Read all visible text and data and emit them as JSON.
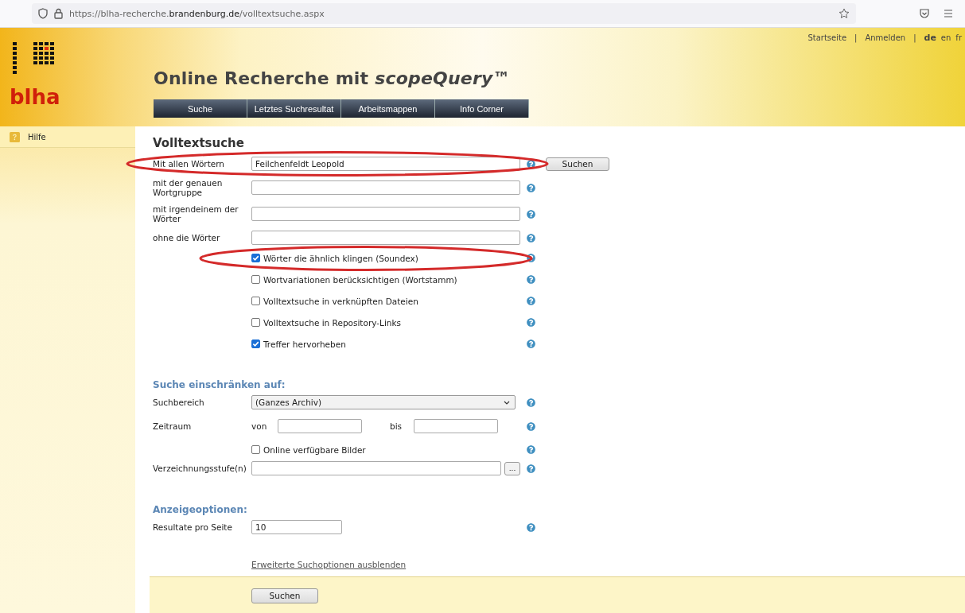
{
  "browser": {
    "url": "https://blha-recherche.**brandenburg.de**/volltextsuche.aspx"
  },
  "header": {
    "logo_text": "blha",
    "top_links": [
      "Startseite",
      "Anmelden"
    ],
    "separator": "|",
    "languages": [
      {
        "label": "de",
        "selected": true
      },
      {
        "label": "en",
        "selected": false
      },
      {
        "label": "fr",
        "selected": false
      }
    ],
    "title": "Online Recherche mit *scopeQuery*™",
    "nav": [
      "Suche",
      "Letztes Suchresultat",
      "Arbeitsmappen",
      "Info Corner"
    ]
  },
  "sidebar": {
    "items": [
      {
        "label": "Hilfe"
      }
    ]
  },
  "form": {
    "title": "Volltextsuche",
    "fields": [
      {
        "label": "Mit allen Wörtern",
        "value": "Feilchenfeldt Leopold",
        "annotated": true
      },
      {
        "label": "mit der genauen Wortgruppe"
      },
      {
        "label": "mit irgendeinem der Wörter"
      },
      {
        "label": "ohne die Wörter"
      }
    ],
    "search_button": "Suchen",
    "options": [
      {
        "label": "Wörter die ähnlich klingen (Soundex)",
        "checked": true,
        "annotated": true
      },
      {
        "label": "Wortvariationen berücksichtigen (Wortstamm)",
        "checked": false
      },
      {
        "label": "Volltextsuche in verknüpften Dateien",
        "checked": false
      },
      {
        "label": "Volltextsuche in Repository-Links",
        "checked": false
      },
      {
        "label": "Treffer hervorheben",
        "checked": true
      }
    ],
    "restrict": {
      "heading": "Suche einschränken auf:",
      "scope_label": "Suchbereich",
      "scope_value": "(Ganzes Archiv)",
      "period_label": "Zeitraum",
      "from_label": "von",
      "to_label": "bis",
      "images": {
        "label": "Online verfügbare Bilder",
        "checked": false
      },
      "levels_label": "Verzeichnungsstufe(n)",
      "levels_button": "..."
    },
    "display": {
      "heading": "Anzeigeoptionen:",
      "rows_label": "Resultate pro Seite",
      "rows_value": "10"
    },
    "toggle_link": "Erweiterte Suchoptionen ausblenden",
    "submit": "Suchen"
  }
}
